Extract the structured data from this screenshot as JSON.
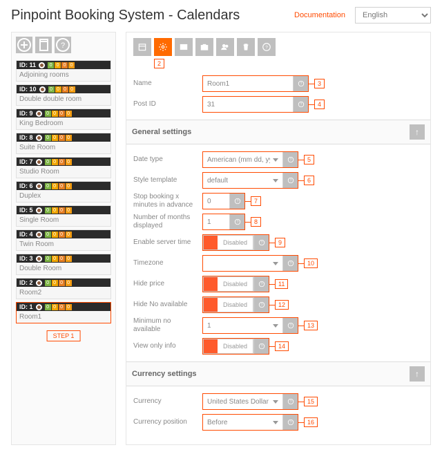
{
  "header": {
    "title": "Pinpoint Booking System - Calendars",
    "doc": "Documentation",
    "lang": "English"
  },
  "sidebar": {
    "step": "STEP 1",
    "items": [
      {
        "id": "ID: 11",
        "name": "Adjoining rooms"
      },
      {
        "id": "ID: 10",
        "name": "Double double room"
      },
      {
        "id": "ID: 9",
        "name": "King Bedroom"
      },
      {
        "id": "ID: 8",
        "name": "Suite Room"
      },
      {
        "id": "ID: 7",
        "name": "Studio Room"
      },
      {
        "id": "ID: 6",
        "name": "Duplex"
      },
      {
        "id": "ID: 5",
        "name": "Single Room"
      },
      {
        "id": "ID: 4",
        "name": "Twin Room"
      },
      {
        "id": "ID: 3",
        "name": "Double Room"
      },
      {
        "id": "ID: 2",
        "name": "Room2"
      },
      {
        "id": "ID: 1",
        "name": "Room1"
      }
    ]
  },
  "callouts": {
    "c2": "2",
    "c3": "3",
    "c4": "4",
    "c5": "5",
    "c6": "6",
    "c7": "7",
    "c8": "8",
    "c9": "9",
    "c10": "10",
    "c11": "11",
    "c12": "12",
    "c13": "13",
    "c14": "14",
    "c15": "15",
    "c16": "16"
  },
  "fields": {
    "name": {
      "label": "Name",
      "value": "Room1"
    },
    "postid": {
      "label": "Post ID",
      "value": "31"
    }
  },
  "sections": {
    "general": "General settings",
    "currency": "Currency settings"
  },
  "general": {
    "datetype": {
      "label": "Date type",
      "value": "American (mm dd, yyyy)"
    },
    "style": {
      "label": "Style template",
      "value": "default"
    },
    "stop": {
      "label": "Stop booking x minutes in advance",
      "value": "0"
    },
    "months": {
      "label": "Number of months displayed",
      "value": "1"
    },
    "server": {
      "label": "Enable server time",
      "value": "Disabled"
    },
    "tz": {
      "label": "Timezone",
      "value": ""
    },
    "hideprice": {
      "label": "Hide price",
      "value": "Disabled"
    },
    "hideno": {
      "label": "Hide No available",
      "value": "Disabled"
    },
    "minno": {
      "label": "Minimum no available",
      "value": "1"
    },
    "viewonly": {
      "label": "View only info",
      "value": "Disabled"
    }
  },
  "currency": {
    "cur": {
      "label": "Currency",
      "value": "United States Dollar"
    },
    "pos": {
      "label": "Currency position",
      "value": "Before"
    }
  }
}
